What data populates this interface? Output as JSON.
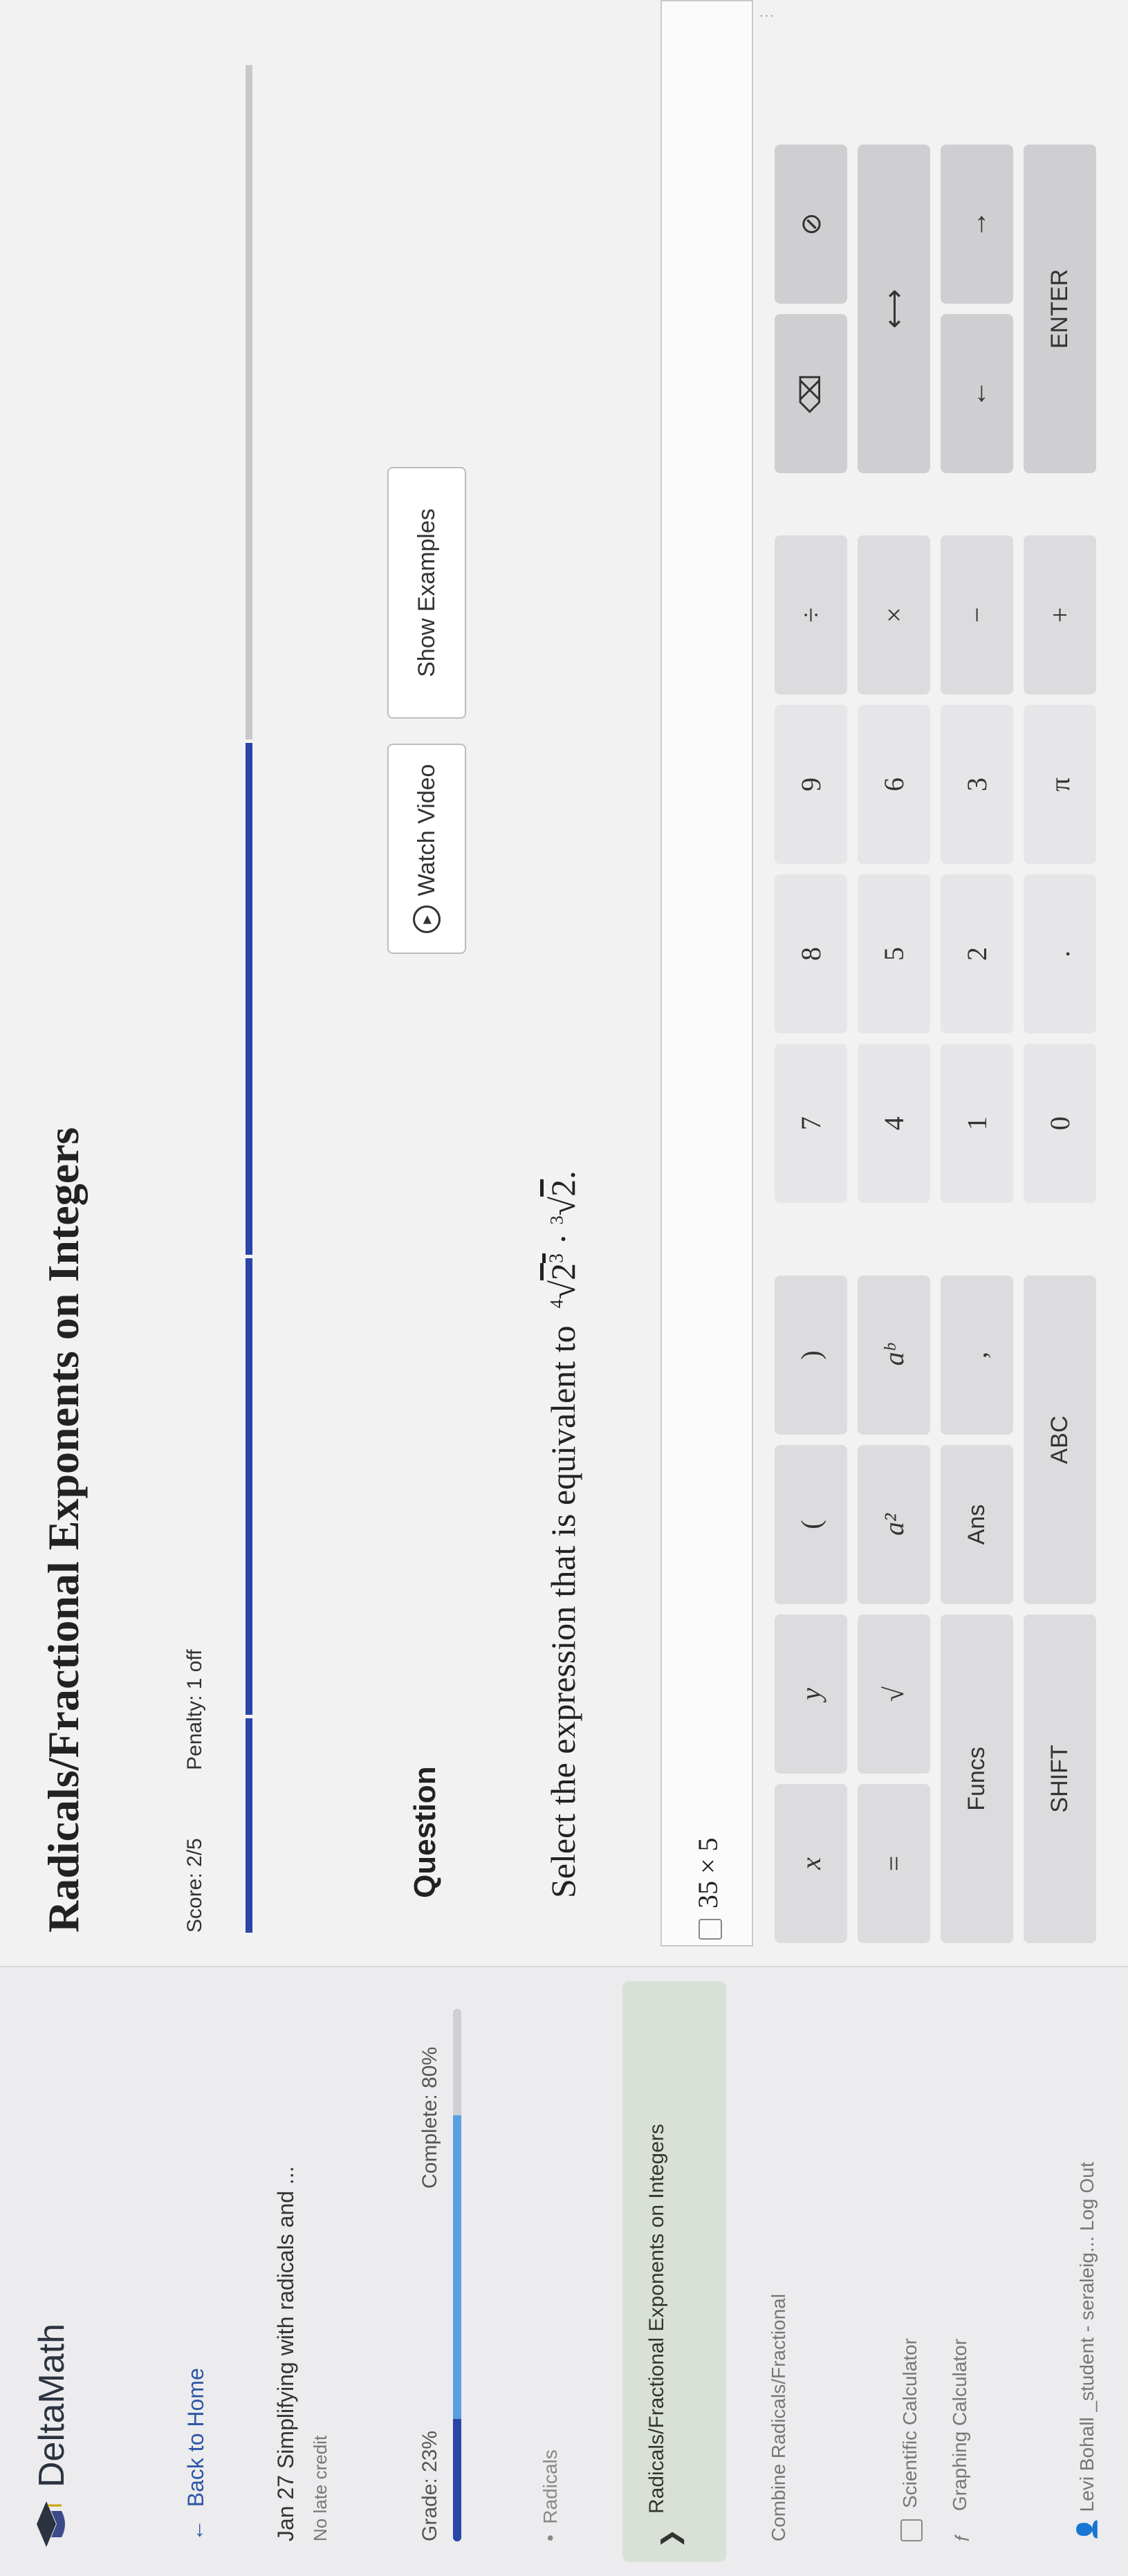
{
  "sidebar": {
    "brand": "DeltaMath",
    "back_label": "Back to Home",
    "assignment": "Jan 27 Simplifying with radicals and ...",
    "late_note": "No late credit",
    "grade": "Grade: 23%",
    "complete": "Complete: 80%",
    "grade_fraction": 0.23,
    "complete_fraction": 0.8,
    "skills": [
      "Radicals",
      "Radicals/Fractional Exponents on Integers",
      "Combine Radicals/Fractional"
    ],
    "tools": [
      "Scientific Calculator",
      "Graphing Calculator"
    ],
    "user": "Levi Bohall _student - seraleig...  Log Out"
  },
  "main": {
    "title": "Radicals/Fractional Exponents on Integers",
    "score": "Score: 2/5",
    "penalty": "Penalty: 1 off",
    "question_label": "Question",
    "watch_video": "Watch Video",
    "show_examples": "Show Examples",
    "prompt": "Select the expression that is equivalent to",
    "answer_value": "35 × 5"
  },
  "keypad": {
    "row1": [
      "x",
      "y",
      "(",
      ")",
      "7",
      "8",
      "9",
      "÷",
      "⌫",
      "⊘"
    ],
    "row2": [
      "=",
      "√",
      "a²",
      "aᵇ",
      "4",
      "5",
      "6",
      "×",
      "⟷"
    ],
    "row3": [
      "Funcs",
      "Ans",
      ",",
      "1",
      "2",
      "3",
      "−",
      "←",
      "→"
    ],
    "row4": [
      "SHIFT",
      "ABC",
      "0",
      ".",
      "π",
      "+",
      "ENTER"
    ]
  },
  "colors": {
    "accent_dark": "#2845a8",
    "accent_light": "#58a0e0"
  }
}
